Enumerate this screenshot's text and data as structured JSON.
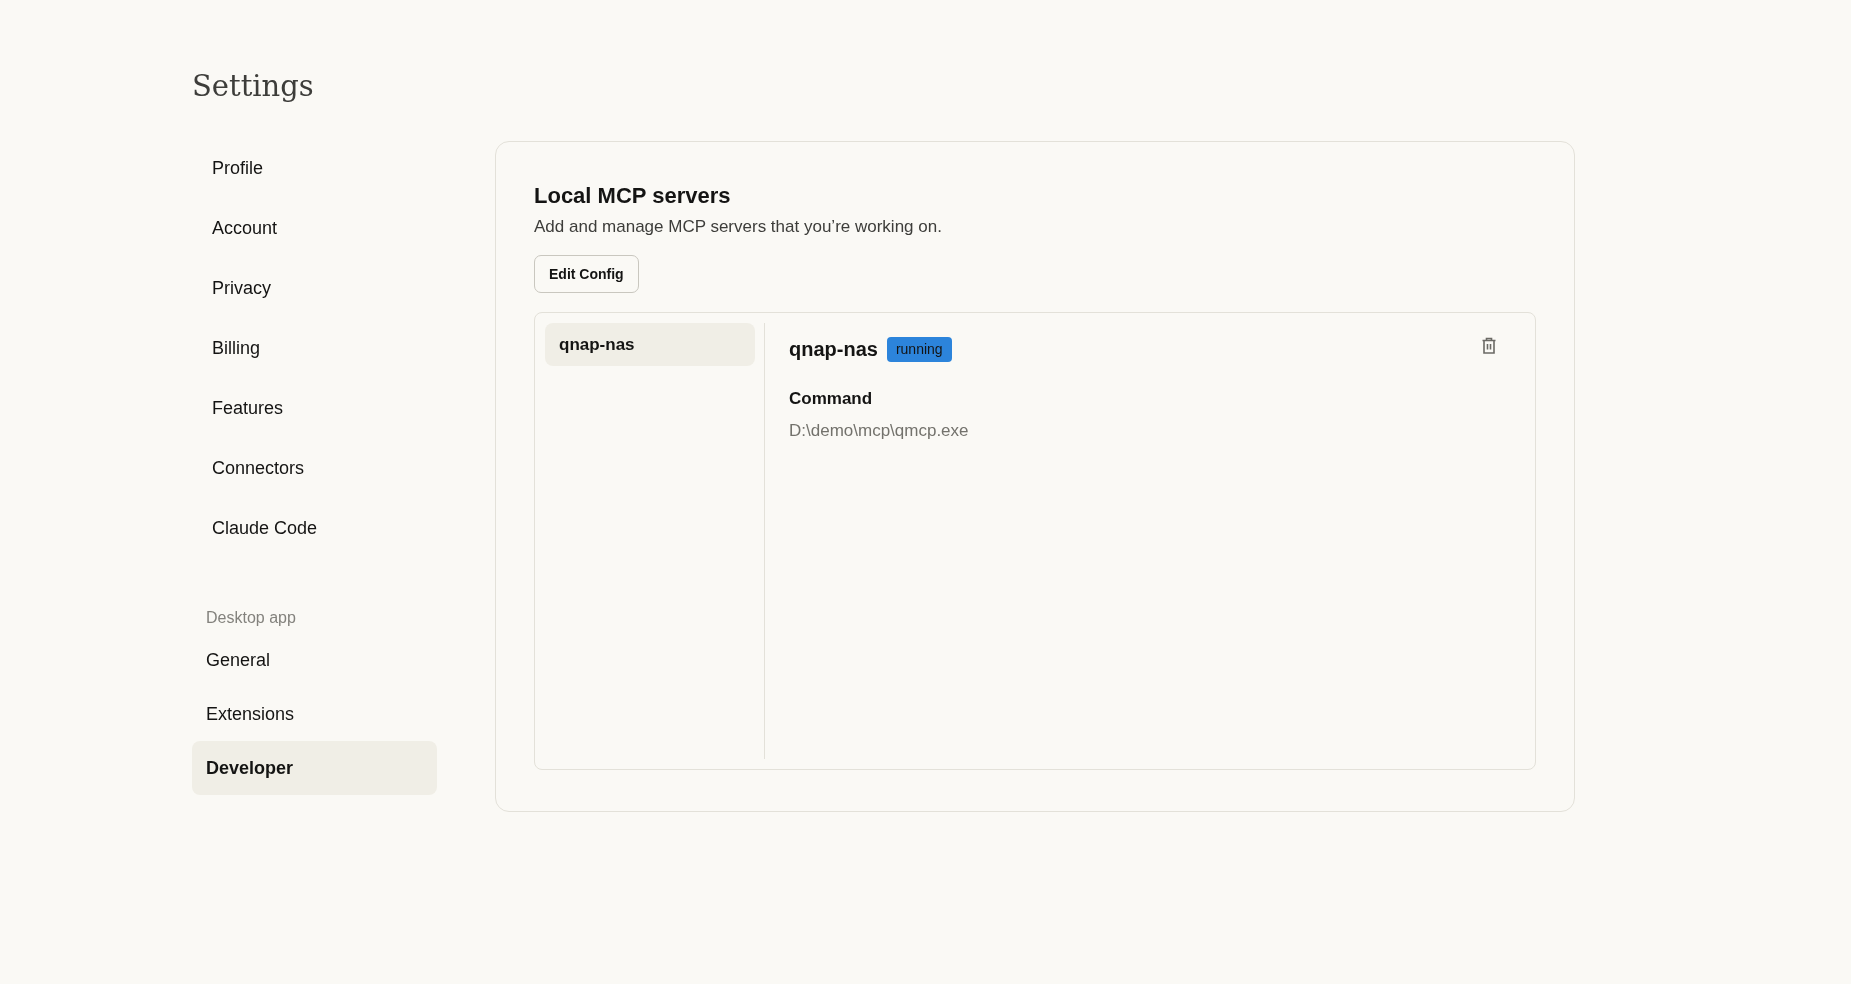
{
  "page": {
    "title": "Settings"
  },
  "sidebar": {
    "items": [
      {
        "label": "Profile",
        "selected": false
      },
      {
        "label": "Account",
        "selected": false
      },
      {
        "label": "Privacy",
        "selected": false
      },
      {
        "label": "Billing",
        "selected": false
      },
      {
        "label": "Features",
        "selected": false
      },
      {
        "label": "Connectors",
        "selected": false
      },
      {
        "label": "Claude Code",
        "selected": false
      }
    ],
    "section": {
      "heading": "Desktop app",
      "items": [
        {
          "label": "General",
          "selected": false
        },
        {
          "label": "Extensions",
          "selected": false
        },
        {
          "label": "Developer",
          "selected": true
        }
      ]
    }
  },
  "panel": {
    "title": "Local MCP servers",
    "description": "Add and manage MCP servers that you’re working on.",
    "button": "Edit Config",
    "servers": [
      {
        "name": "qnap-nas",
        "selected": true
      }
    ],
    "detail": {
      "name": "qnap-nas",
      "status": "running",
      "command_label": "Command",
      "command": "D:\\demo\\mcp\\qmcp.exe"
    }
  }
}
